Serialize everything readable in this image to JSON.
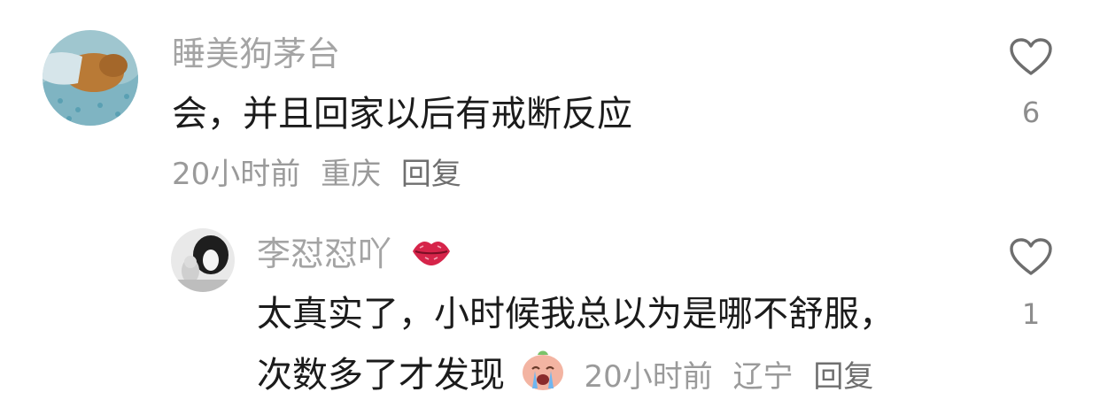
{
  "comments": [
    {
      "username": "睡美狗茅台",
      "content": "会，并且回家以后有戒断反应",
      "time": "20小时前",
      "location": "重庆",
      "reply_label": "回复",
      "like_count": "6"
    },
    {
      "username": "李怼怼吖",
      "username_badge_icon": "lips-icon",
      "content_line1": "太真实了，小时候我总以为是哪不舒服，",
      "content_line2": "次数多了才发现",
      "emoji_icon": "crying-emoji-icon",
      "time": "20小时前",
      "location": "辽宁",
      "reply_label": "回复",
      "like_count": "1"
    }
  ],
  "colors": {
    "username": "#a4a4a4",
    "content": "#1b1b1b",
    "meta": "#9a9a9a",
    "lips": "#d6244a"
  }
}
